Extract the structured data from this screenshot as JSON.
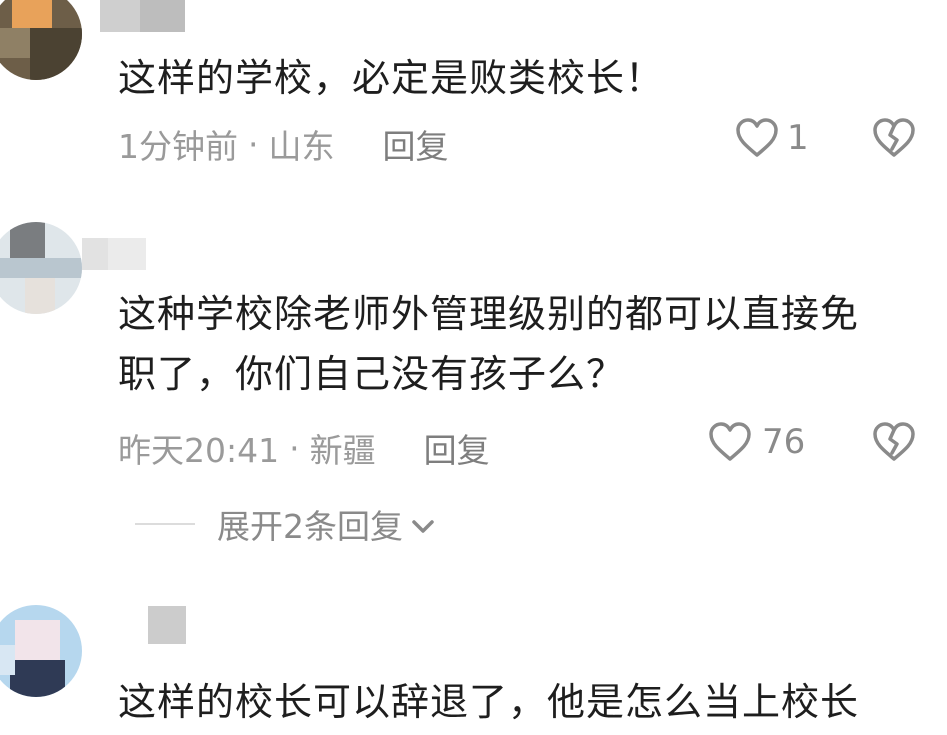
{
  "comments": [
    {
      "text_lines": [
        "这样的学校，必定是败类校长！"
      ],
      "time": "1分钟前",
      "separator": "·",
      "location": "山东",
      "reply_label": "回复",
      "like_count": "1"
    },
    {
      "text_lines": [
        "这种学校除老师外管理级别的都可以直接免",
        "职了，你们自己没有孩子么？"
      ],
      "time": "昨天20:41",
      "separator": "·",
      "location": "新疆",
      "reply_label": "回复",
      "like_count": "76",
      "expand_label": "展开2条回复"
    },
    {
      "text_lines": [
        "这样的校长可以辞退了，他是怎么当上校长"
      ]
    }
  ],
  "icons": {
    "like": "heart-outline-icon",
    "dislike": "broken-heart-icon",
    "expand": "chevron-down-icon"
  },
  "colors": {
    "text": "#1e1e1e",
    "meta": "#9a9a9a",
    "icon": "#8a8a8a"
  }
}
